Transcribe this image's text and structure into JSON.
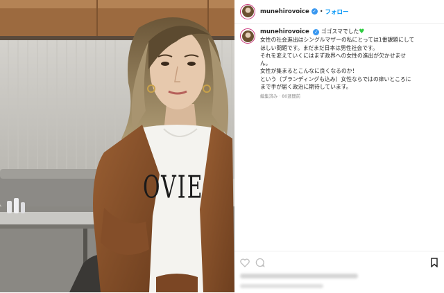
{
  "post": {
    "username": "munehirovoice",
    "verified_icon": "verified-badge-icon",
    "follow_separator": "•",
    "follow_label": "フォロー"
  },
  "caption": {
    "lines": [
      "ゴゴスマでした",
      "女性の社会進出はシングルマザーの私にとっては1番課題にして",
      "ほしい問題です。まだまだ日本は男性社会です。",
      "それを変えていくにはまず政界への女性の進出が欠かせませ",
      "ん。",
      "女性が集まるとこんなに良くなるのか！",
      "という（ブランディングも込み）女性ならではの痒いところに",
      "まで手が届く政治に期待しています。"
    ],
    "emoji_icon": "green-heart-icon",
    "meta": "編集済み · 80週間前"
  },
  "photo": {
    "shirt_print": "OVIE"
  },
  "colors": {
    "accent": "#0095f6",
    "verified": "#3897f0",
    "heart": "#2ecc40"
  }
}
